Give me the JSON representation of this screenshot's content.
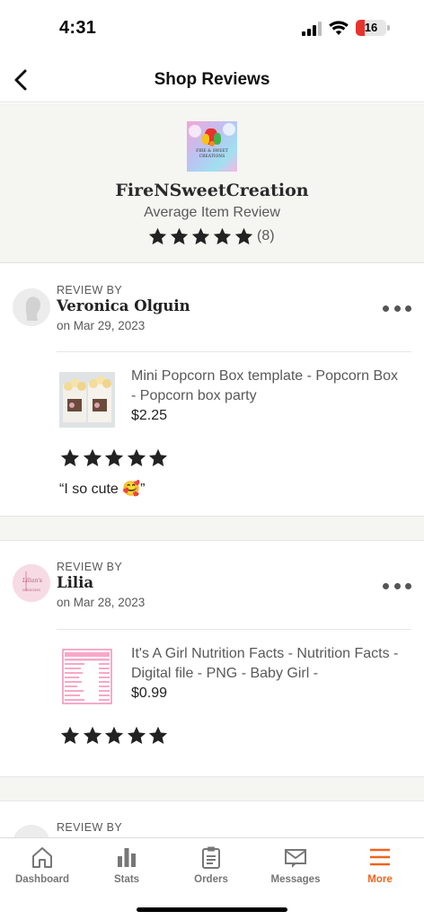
{
  "status_bar": {
    "time": "4:31",
    "battery": "16"
  },
  "header": {
    "title": "Shop Reviews"
  },
  "shop": {
    "logo_text": [
      "FIRE & SWEET",
      "CREATIONS"
    ],
    "name": "FireNSweetCreation",
    "average_label": "Average Item Review",
    "rating": 5,
    "review_count": "(8)"
  },
  "reviews": [
    {
      "review_by_label": "REVIEW BY",
      "reviewer": "Veronica Olguin",
      "date": "on Mar 29, 2023",
      "item_title": "Mini Popcorn Box template - Popcorn Box - Popcorn box party",
      "item_price": "$2.25",
      "rating": 5,
      "text": "“I so cute 🥰”"
    },
    {
      "review_by_label": "REVIEW BY",
      "reviewer": "Lilia",
      "avatar_text": [
        "Lilian's",
        "DESIGNS"
      ],
      "date": "on Mar 28, 2023",
      "item_title": "It's A Girl Nutrition Facts - Nutrition Facts - Digital file - PNG - Baby Girl -",
      "item_price": "$0.99",
      "rating": 5
    },
    {
      "review_by_label": "REVIEW BY"
    }
  ],
  "tabs": [
    {
      "label": "Dashboard",
      "icon": "home-icon"
    },
    {
      "label": "Stats",
      "icon": "bar-chart-icon"
    },
    {
      "label": "Orders",
      "icon": "clipboard-icon"
    },
    {
      "label": "Messages",
      "icon": "envelope-icon"
    },
    {
      "label": "More",
      "icon": "hamburger-menu-icon",
      "active": true
    }
  ],
  "colors": {
    "accent": "#f1641e",
    "star": "#222222",
    "background_alt": "#f5f5f1"
  }
}
